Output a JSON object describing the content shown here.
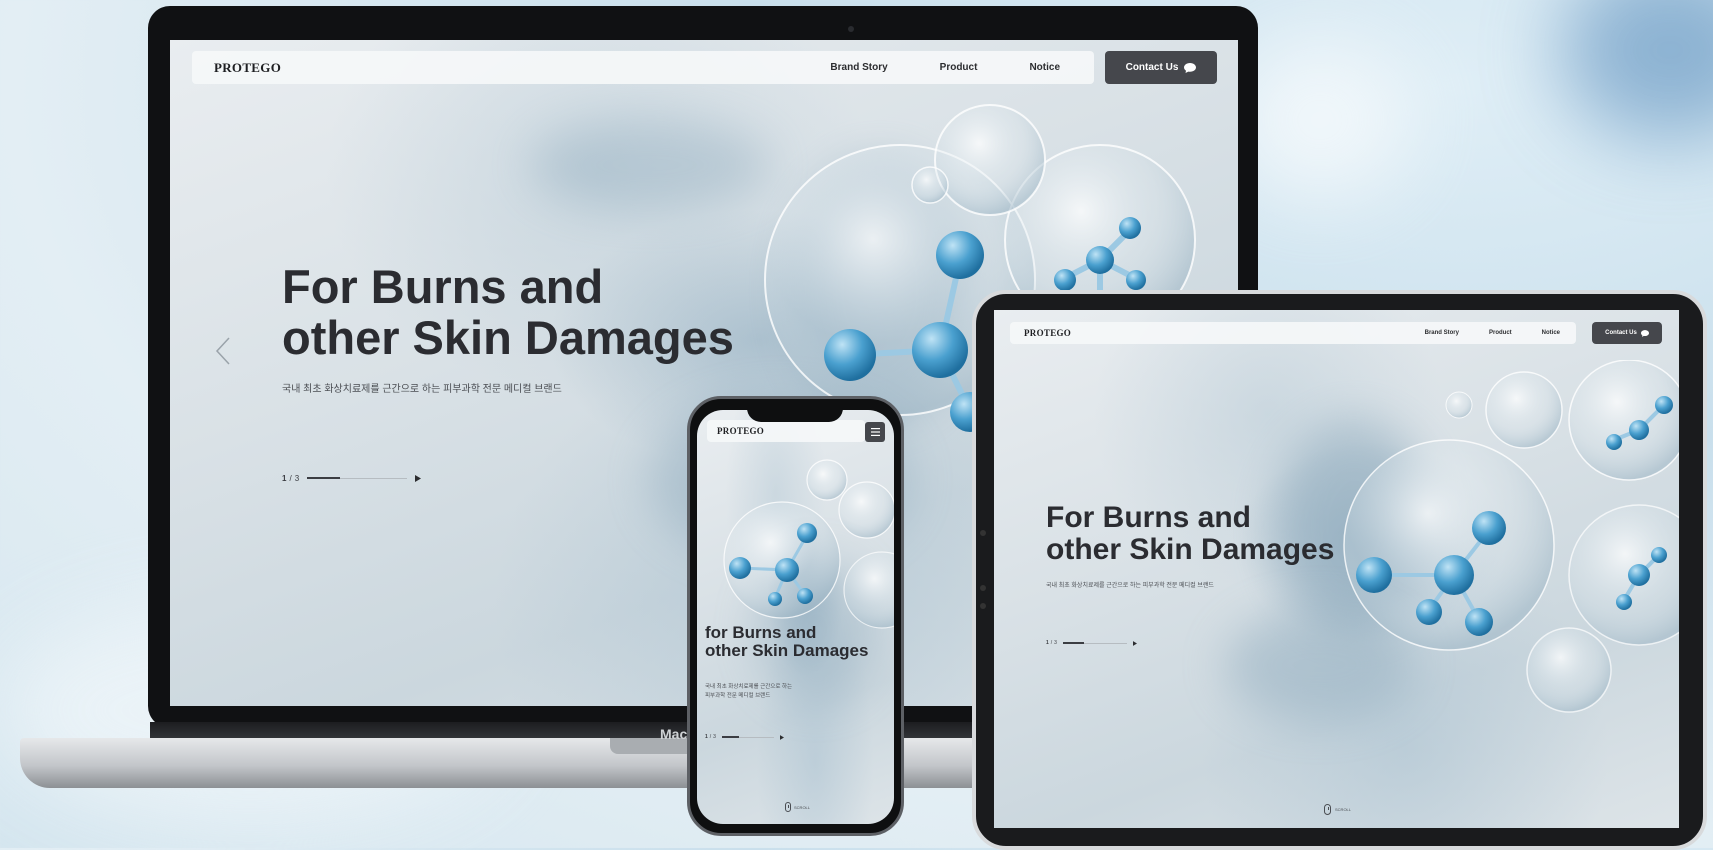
{
  "brand": "PROTEGO",
  "nav": {
    "links": [
      "Brand Story",
      "Product",
      "Notice"
    ],
    "contact_label": "Contact Us"
  },
  "hero": {
    "line1": "For Burns and",
    "line2": "other Skin Damages",
    "mobile_line1": "for Burns and",
    "mobile_line2": "other Skin Damages",
    "subtitle": "국내 최초 화상치료제를 근간으로 하는 피부과학 전문 메디컬 브랜드",
    "mobile_subtitle_1": "국내 최초 화상치료제를 근간으로 하는",
    "mobile_subtitle_2": "피부과학 전문 메디컬 브랜드"
  },
  "slider": {
    "current": "1",
    "separator": "/",
    "total": "3",
    "progress": 0.33
  },
  "scroll_label": "SCROLL",
  "laptop_brand": "Mac",
  "icons": {
    "chat": "chat-bubble-icon",
    "menu": "hamburger-menu-icon",
    "play": "play-icon",
    "prev": "chevron-left-icon",
    "mouse": "mouse-scroll-icon"
  },
  "colors": {
    "accent_dark": "#45474c",
    "molecule_blue": "#3d93c7",
    "text_dark": "#2b2c31"
  }
}
